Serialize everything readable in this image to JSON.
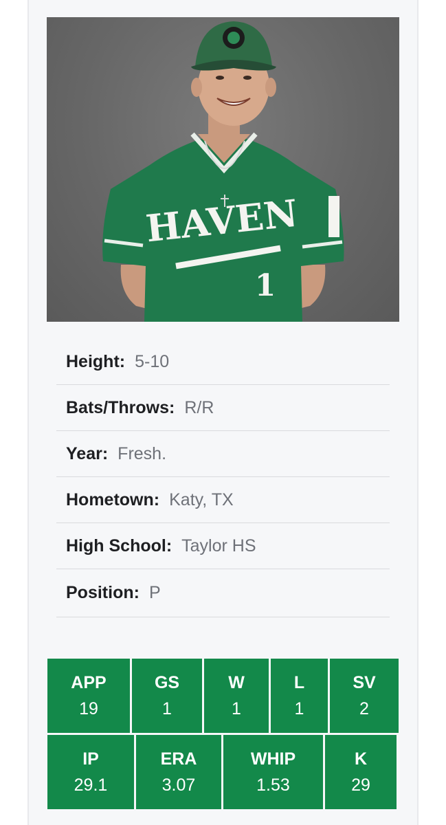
{
  "bio": [
    {
      "label": "Height:",
      "value": "5-10"
    },
    {
      "label": "Bats/Throws:",
      "value": "R/R"
    },
    {
      "label": "Year:",
      "value": "Fresh."
    },
    {
      "label": "Hometown:",
      "value": "Katy, TX"
    },
    {
      "label": "High School:",
      "value": "Taylor HS"
    },
    {
      "label": "Position:",
      "value": "P"
    }
  ],
  "stats_row1": [
    {
      "label": "APP",
      "value": "19"
    },
    {
      "label": "GS",
      "value": "1"
    },
    {
      "label": "W",
      "value": "1"
    },
    {
      "label": "L",
      "value": "1"
    },
    {
      "label": "SV",
      "value": "2"
    }
  ],
  "stats_row2": [
    {
      "label": "IP",
      "value": "29.1"
    },
    {
      "label": "ERA",
      "value": "3.07"
    },
    {
      "label": "WHIP",
      "value": "1.53"
    },
    {
      "label": "K",
      "value": "29"
    }
  ],
  "photo": {
    "jersey_text": "HAVEN",
    "jersey_number": "1"
  },
  "colors": {
    "stat_green": "#13894a",
    "jersey_green": "#1f7a4c",
    "background": "#f6f7f9"
  }
}
